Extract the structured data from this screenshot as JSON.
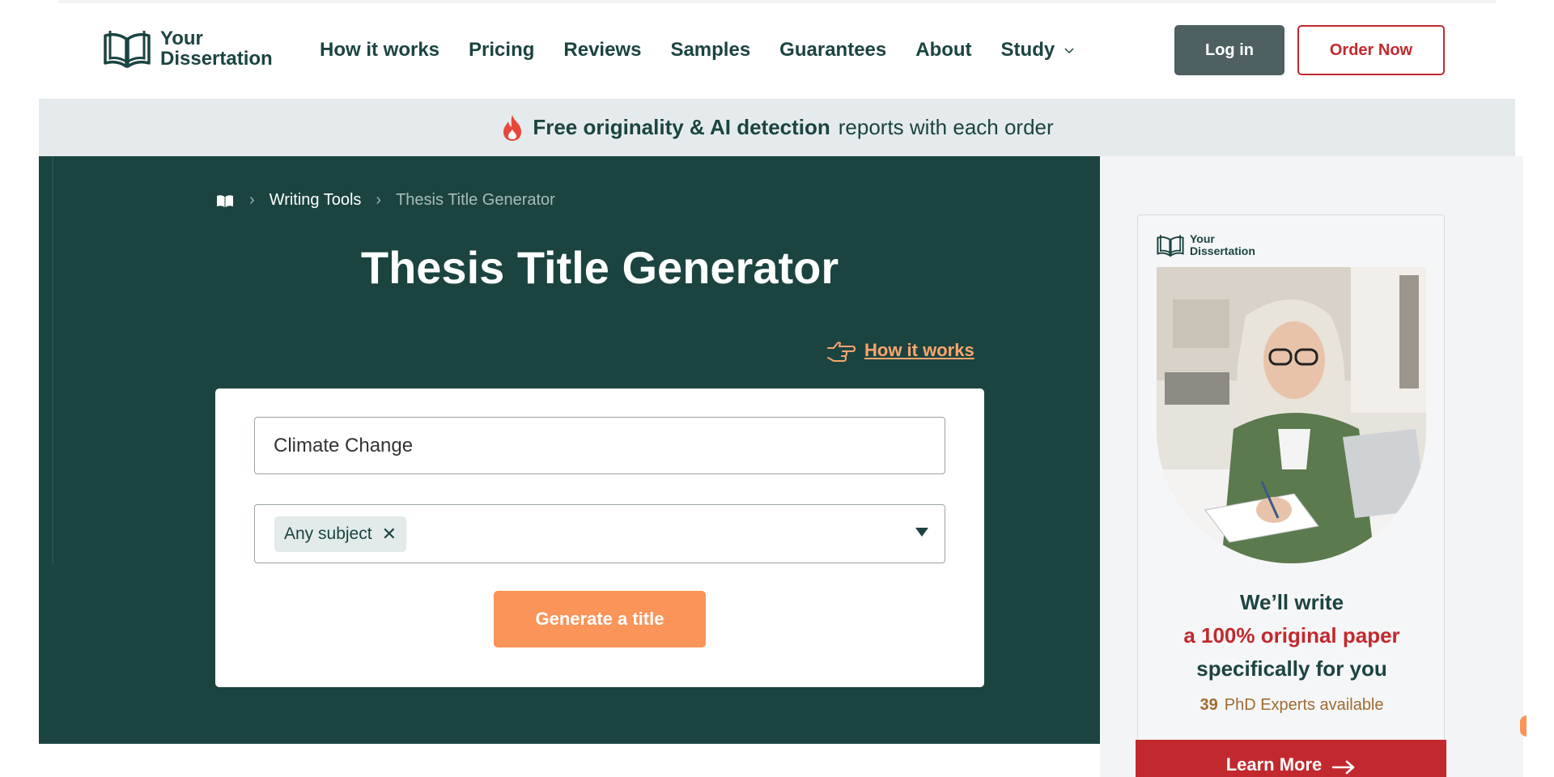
{
  "brand": {
    "line1": "Your",
    "line2": "Dissertation",
    "accent": "#1b4441",
    "red": "#c2292e",
    "orange": "#fa9458"
  },
  "nav": {
    "items": [
      "How it works",
      "Pricing",
      "Reviews",
      "Samples",
      "Guarantees",
      "About",
      "Study"
    ],
    "login_label": "Log in",
    "order_label": "Order Now"
  },
  "promo": {
    "bold": "Free originality & AI detection",
    "rest": "reports with each order"
  },
  "breadcrumb": {
    "items": [
      "Writing Tools",
      "Thesis Title Generator"
    ]
  },
  "hero": {
    "title": "Thesis Title Generator",
    "how_it_works": "How it works"
  },
  "form": {
    "topic_value": "Climate Change",
    "subject_chip": "Any subject",
    "generate_label": "Generate a title"
  },
  "ad": {
    "logo_line1": "Your",
    "logo_line2": "Dissertation",
    "headline1": "We’ll write",
    "headline2": "a 100% original paper",
    "headline3": "specifically for you",
    "experts_count": "39",
    "experts_label": "PhD Experts available",
    "learn_more": "Learn More"
  }
}
